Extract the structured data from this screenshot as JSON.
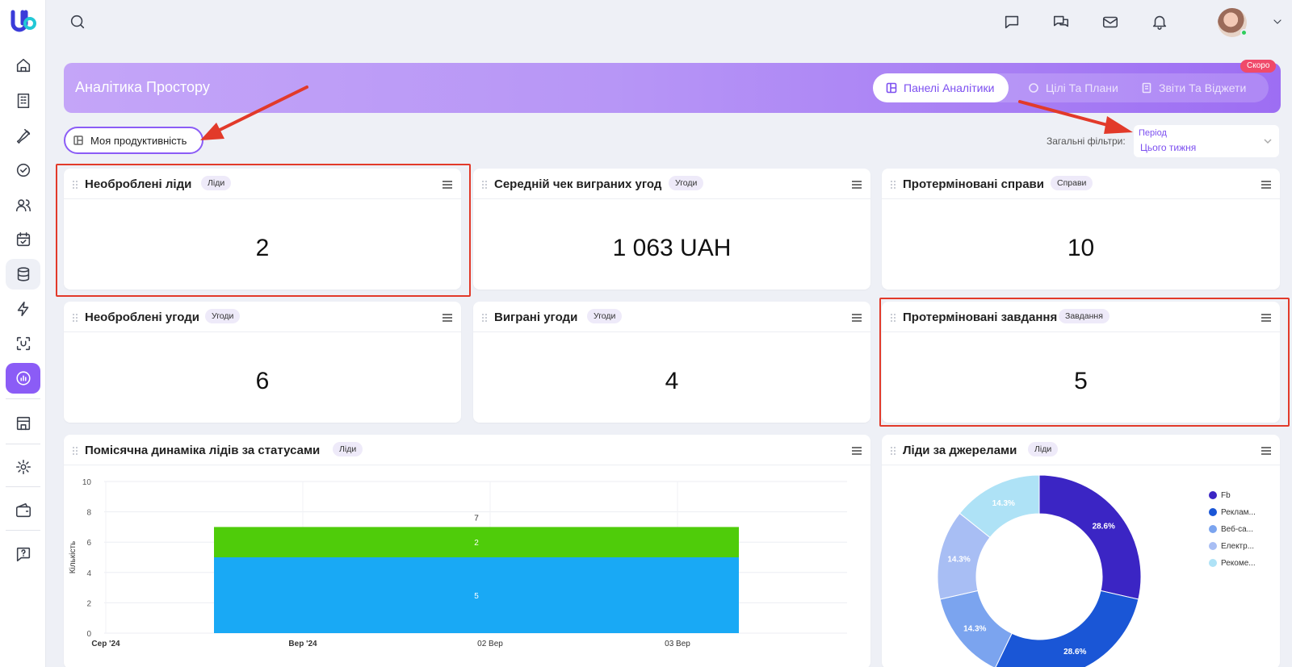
{
  "header": {
    "title": "Аналітика Простору",
    "tabs": [
      {
        "label": "Панелі Аналітики",
        "active": true
      },
      {
        "label": "Цілі Та Плани",
        "active": false
      },
      {
        "label": "Звіти Та Віджети",
        "active": false
      }
    ],
    "soon_badge": "Скоро"
  },
  "filters": {
    "my_productivity": "Моя продуктивність",
    "general_label": "Загальні фільтри:",
    "period_label": "Період",
    "period_value": "Цього тижня"
  },
  "widgets": [
    {
      "title": "Необроблені ліди",
      "badge": "Ліди",
      "value": "2"
    },
    {
      "title": "Середній чек виграних угод",
      "badge": "Угоди",
      "value": "1 063 UAH"
    },
    {
      "title": "Протерміновані справи",
      "badge": "Справи",
      "value": "10"
    },
    {
      "title": "Необроблені угоди",
      "badge": "Угоди",
      "value": "6"
    },
    {
      "title": "Виграні угоди",
      "badge": "Угоди",
      "value": "4"
    },
    {
      "title": "Протерміновані завдання",
      "badge": "Завдання",
      "value": "5"
    }
  ],
  "chart_data": [
    {
      "type": "bar",
      "title": "Помісячна динаміка лідів за статусами",
      "badge": "Ліди",
      "ylabel": "Кількість",
      "ylim": [
        0,
        10
      ],
      "yticks": [
        "0",
        "2",
        "4",
        "6",
        "8",
        "10"
      ],
      "xticks": [
        "Сер '24",
        "Вер '24",
        "02 Вер",
        "03 Вер"
      ],
      "stacked": true,
      "categories": [
        "02 Вер"
      ],
      "series": [
        {
          "values": [
            5
          ],
          "color": "#19a9f5"
        },
        {
          "values": [
            2
          ],
          "color": "#4fcc0a"
        }
      ],
      "total_labels": [
        "7"
      ]
    },
    {
      "type": "pie",
      "donut": true,
      "title": "Ліди за джерелами",
      "badge": "Ліди",
      "labels": [
        "Fb",
        "Реклам...",
        "Веб-са...",
        "Електр...",
        "Рекоме..."
      ],
      "values": [
        28.6,
        28.6,
        14.3,
        14.3,
        14.3
      ],
      "value_labels": [
        "28.6%",
        "28.6%",
        "14.3%",
        "14.3%",
        "14.3%"
      ],
      "colors": [
        "#3b25c4",
        "#1a56d6",
        "#7ba4ef",
        "#a8bef4",
        "#aee2f6"
      ]
    }
  ],
  "colors": {
    "accent": "#8b5cf6",
    "annotation": "#e23a2a"
  },
  "icons": {
    "sidebar": [
      "home-icon",
      "building-icon",
      "handshake-icon",
      "check-circle-icon",
      "users-icon",
      "calendar-check-icon",
      "database-icon",
      "lightning-icon",
      "scan-icon",
      "analytics-icon",
      "warehouse-icon",
      "gear-icon",
      "wallet-icon",
      "help-icon"
    ],
    "topbar": [
      "search-icon",
      "chat-icon",
      "messages-icon",
      "mail-icon",
      "bell-icon",
      "avatar",
      "chevron-down-icon"
    ]
  }
}
